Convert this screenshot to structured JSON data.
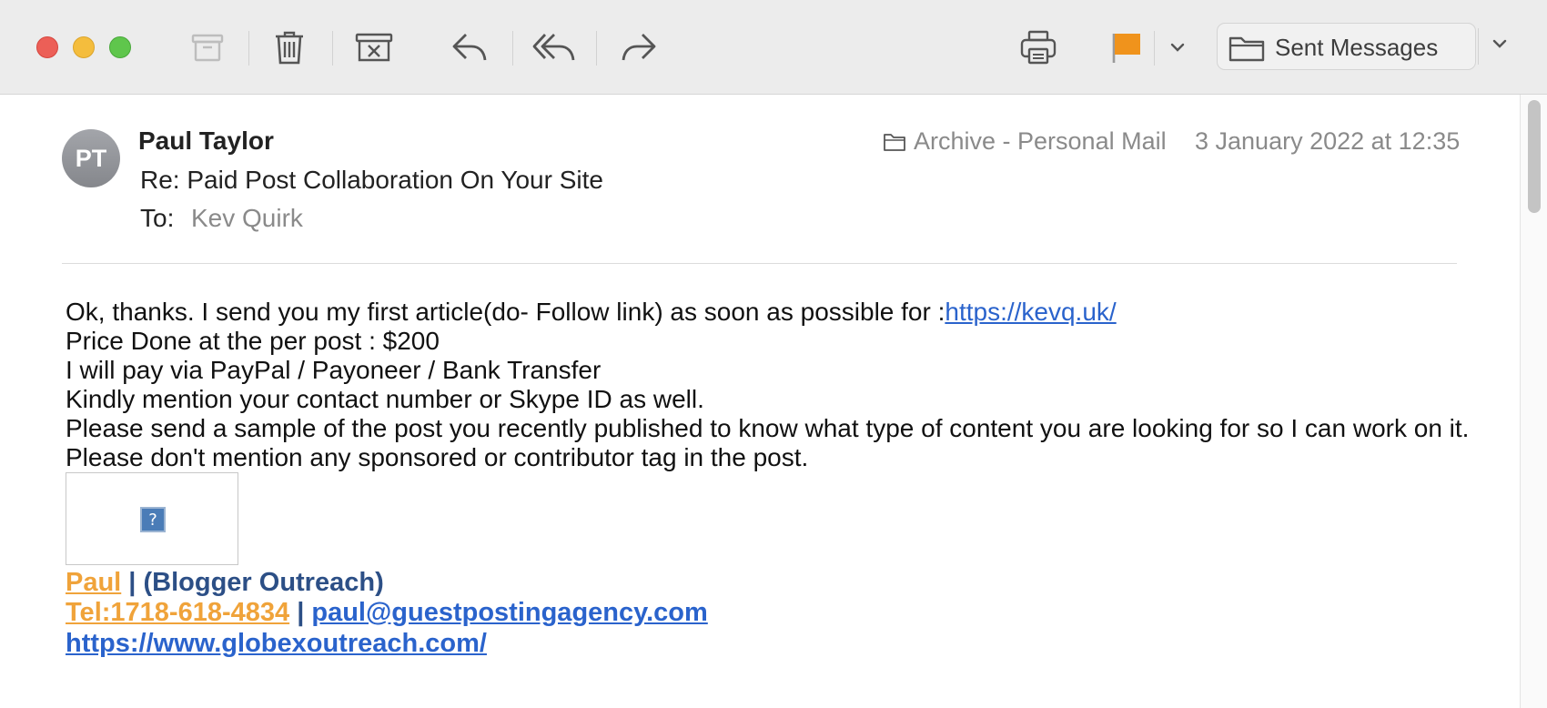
{
  "toolbar": {
    "mailbox_label": "Sent Messages",
    "flag_color": "#f0931c",
    "icons": [
      "archive-icon",
      "trash-icon",
      "junk-icon",
      "reply-icon",
      "reply-all-icon",
      "forward-icon",
      "print-icon",
      "flag-icon",
      "chevron-down-icon",
      "folder-icon"
    ]
  },
  "message": {
    "avatar_initials": "PT",
    "sender": "Paul Taylor",
    "subject": "Re: Paid Post Collaboration On Your Site",
    "to_label": "To:",
    "to_value": "Kev Quirk",
    "mailbox": "Archive - Personal Mail",
    "date": "3 January 2022 at 12:35",
    "body": {
      "line1_text": "Ok, thanks. I send you my first article(do- Follow link) as soon as possible for :",
      "line1_link": "https://kevq.uk/",
      "line2": "Price Done at the per post : $200",
      "line3": "I will pay via PayPal / Payoneer / Bank Transfer",
      "line4": "Kindly mention your contact number or Skype ID as well.",
      "line5": "Please send a sample of the post you recently published to know what type of content you are looking for so I can work on it.",
      "line6": "Please don't mention any sponsored or contributor tag in the post."
    },
    "image_placeholder": "?",
    "signature": {
      "name": "Paul",
      "sep1": " | ",
      "role": "(Blogger Outreach)",
      "tel": "Tel:1718-618-4834",
      "sep2": " | ",
      "email": "paul@guestpostingagency.com",
      "website": "https://www.globexoutreach.com/"
    }
  }
}
